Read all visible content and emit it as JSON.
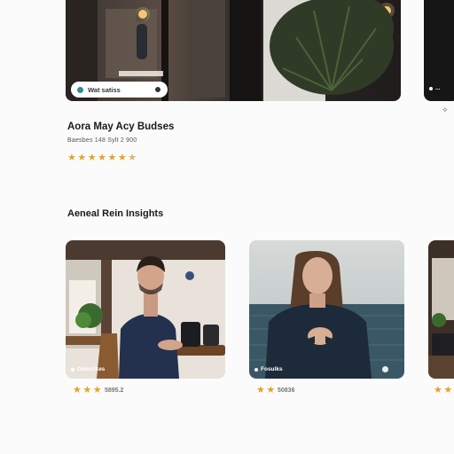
{
  "featured": {
    "pill_text": "Wat satiss",
    "right_card_label": "...",
    "title": "Aora May Acy Budses",
    "subtitle": "Baesbes 148 Sylt 2 900",
    "stars": 7,
    "icons": {
      "pill_left": "location-icon",
      "pill_right": "bookmark-icon",
      "side": "share-icon"
    }
  },
  "section": {
    "title": "Aeneal Rein Insights"
  },
  "insights": [
    {
      "overlay": "Oomulkes",
      "rating_text": "5895.2",
      "stars": 3
    },
    {
      "overlay": "Fosulks",
      "rating_text": "50836",
      "stars": 2
    },
    {
      "overlay": "",
      "rating_text": "",
      "stars": 2
    }
  ],
  "colors": {
    "star": "#e3a32a",
    "accent": "#2f8b8b",
    "background": "#fbfbfb"
  }
}
